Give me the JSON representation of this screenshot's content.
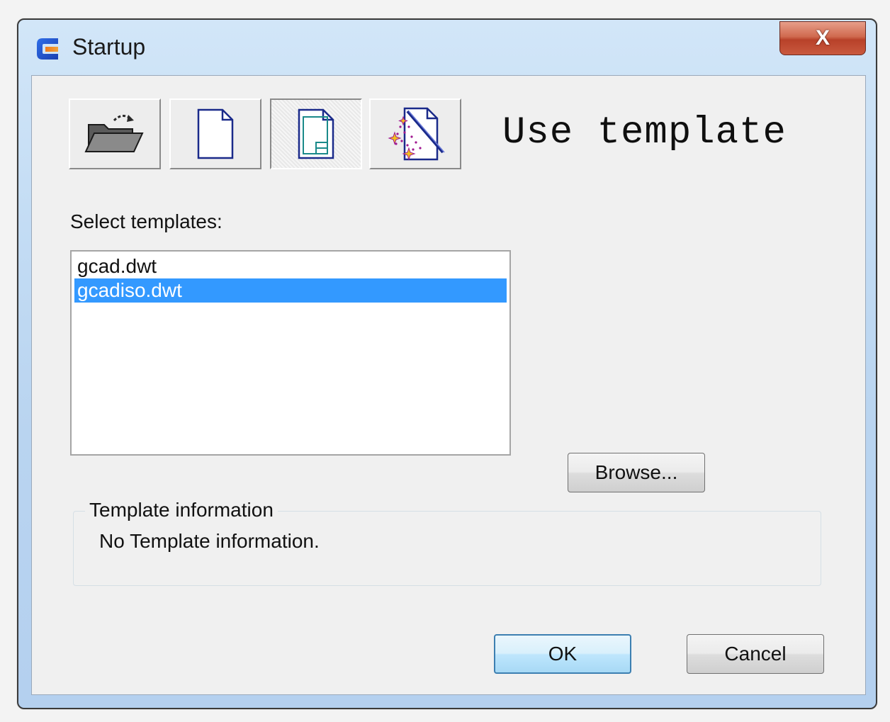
{
  "window": {
    "title": "Startup",
    "close_label": "X"
  },
  "toolbar": {
    "modes": [
      {
        "name": "open-drawing",
        "icon": "open-folder-icon"
      },
      {
        "name": "start-from-scratch",
        "icon": "blank-document-icon"
      },
      {
        "name": "use-template",
        "icon": "template-document-icon"
      },
      {
        "name": "use-wizard",
        "icon": "wizard-document-icon"
      }
    ],
    "active_mode": "use-template"
  },
  "mode_title": "Use template",
  "templates": {
    "label": "Select templates:",
    "items": [
      "gcad.dwt",
      "gcadiso.dwt"
    ],
    "selected": "gcadiso.dwt"
  },
  "browse_label": "Browse...",
  "template_info": {
    "legend": "Template information",
    "text": "No Template information."
  },
  "footer": {
    "ok_label": "OK",
    "cancel_label": "Cancel"
  },
  "colors": {
    "selection": "#3399ff",
    "icon_stroke": "#1a2a8a",
    "icon_teal": "#1a8a8a"
  }
}
